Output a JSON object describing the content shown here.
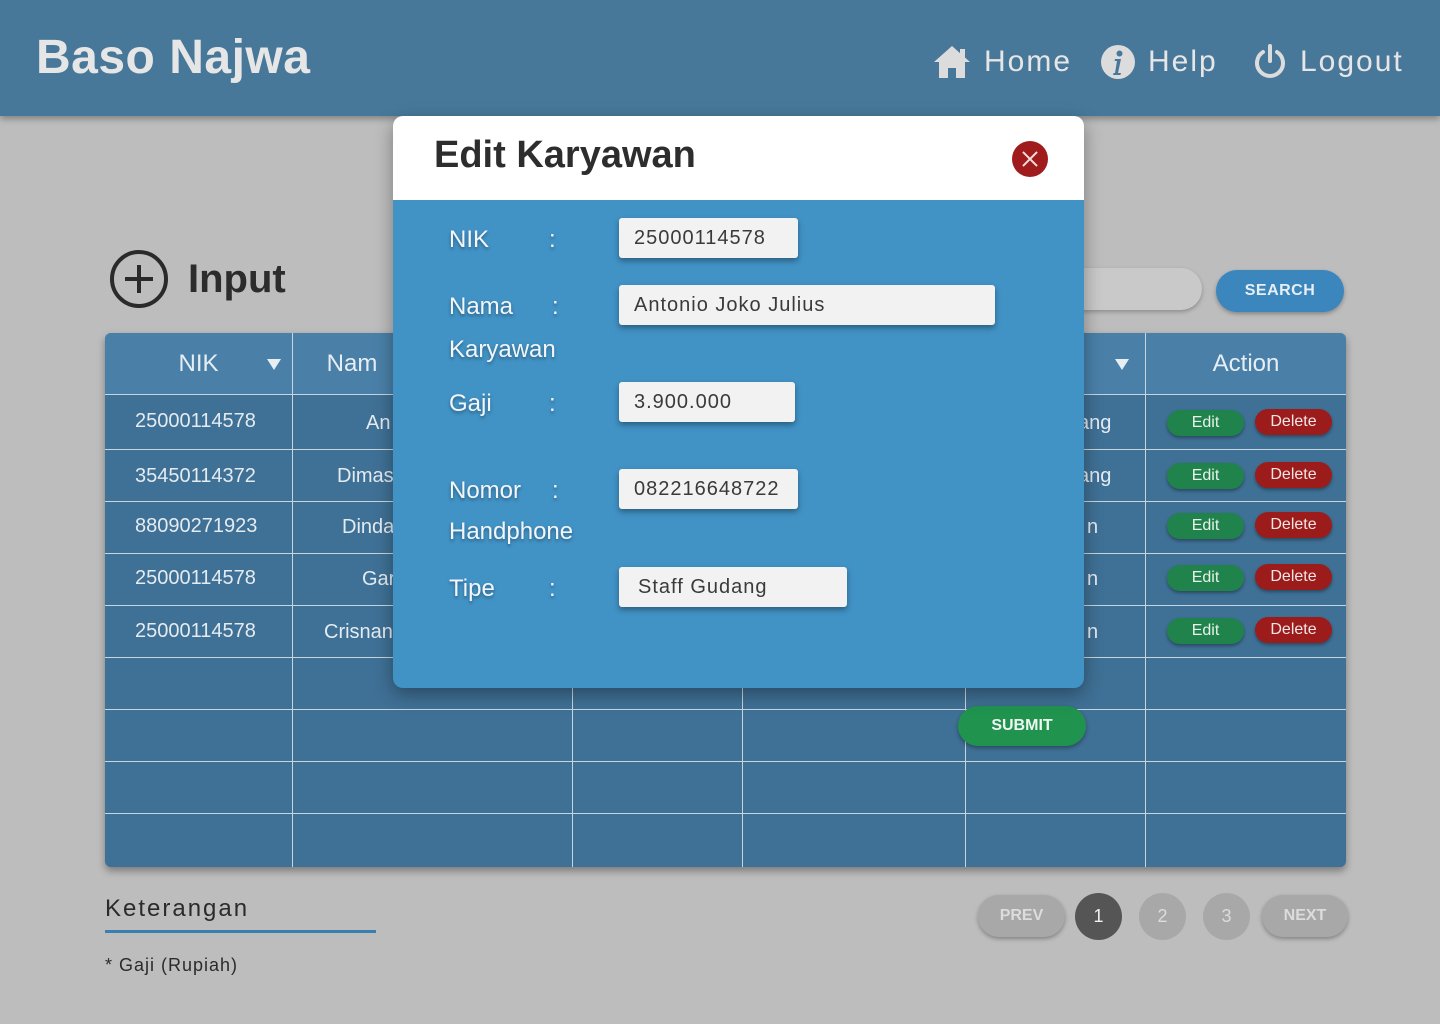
{
  "header": {
    "brand": "Baso Najwa",
    "nav": {
      "home": "Home",
      "help": "Help",
      "logout": "Logout"
    }
  },
  "toolbar": {
    "input_label": "Input",
    "search_label": "SEARCH"
  },
  "table": {
    "headers": {
      "nik": "NIK",
      "nama": "Nam",
      "action": "Action"
    },
    "rows": [
      {
        "nik": "25000114578",
        "nama": "An",
        "tipe": "ang"
      },
      {
        "nik": "35450114372",
        "nama": "Dimas",
        "tipe": "ang"
      },
      {
        "nik": "88090271923",
        "nama": "Dinda",
        "tipe": "n"
      },
      {
        "nik": "25000114578",
        "nama": "Gar",
        "tipe": "n"
      },
      {
        "nik": "25000114578",
        "nama": "Crisnan",
        "tipe": "n"
      }
    ],
    "edit_label": "Edit",
    "delete_label": "Delete"
  },
  "submit_label": "SUBMIT",
  "keterangan": {
    "title": "Keterangan",
    "note": "* Gaji (Rupiah)"
  },
  "pagination": {
    "prev": "PREV",
    "next": "NEXT",
    "pages": [
      "1",
      "2",
      "3"
    ],
    "current": "1"
  },
  "modal": {
    "title": "Edit Karyawan",
    "colon": ":",
    "fields": {
      "nik": {
        "label": "NIK",
        "value": "25000114578"
      },
      "nama": {
        "label_1": "Nama",
        "label_2": "Karyawan",
        "value": "Antonio Joko Julius"
      },
      "gaji": {
        "label": "Gaji",
        "value": "3.900.000"
      },
      "nomor": {
        "label_1": "Nomor",
        "label_2": "Handphone",
        "value": "082216648722"
      },
      "tipe": {
        "label": "Tipe",
        "value": "Staff Gudang"
      }
    }
  },
  "colors": {
    "header": "#47789a",
    "modal": "#4192c5",
    "edit": "#20834c",
    "delete": "#9c1c1c",
    "submit": "#20934f"
  }
}
